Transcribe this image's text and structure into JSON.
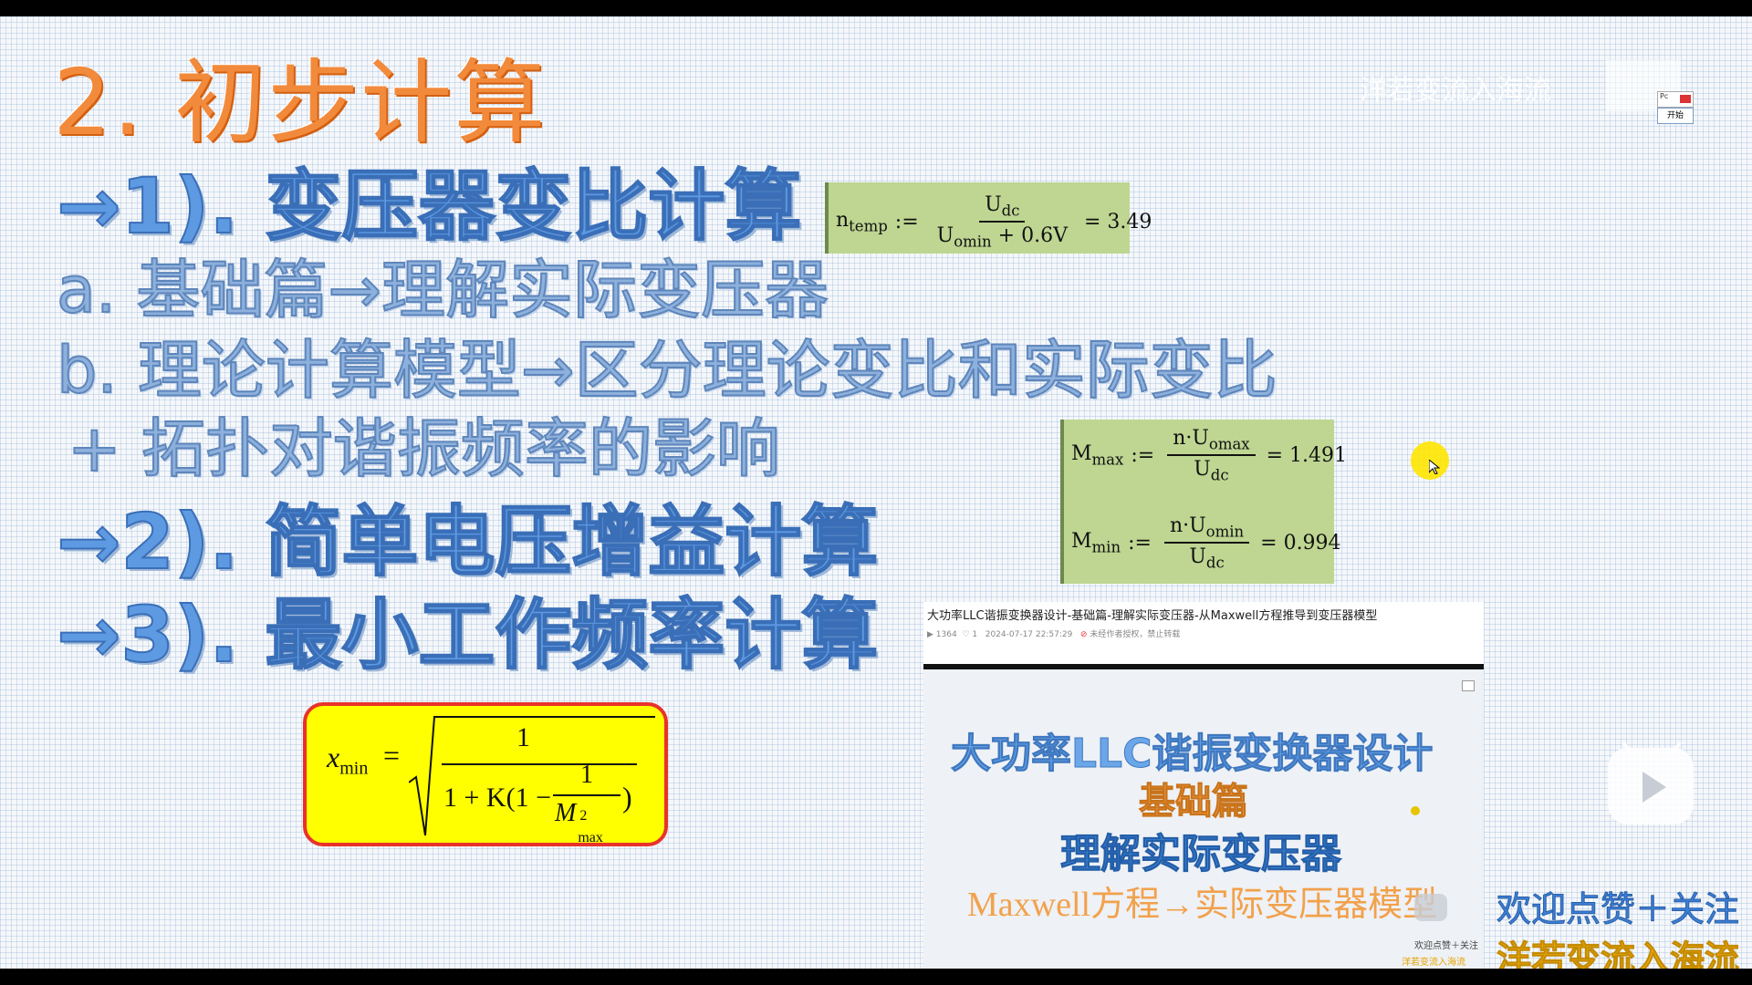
{
  "slide": {
    "title": "2. 初步计算",
    "item1": "→1). 变压器变比计算",
    "item1a": "a. 基础篇→理解实际变压器",
    "item1b": "b. 理论计算模型→区分理论变比和实际变比",
    "item1c": "+ 拓扑对谐振频率的影响",
    "item2": "→2). 简单电压增益计算",
    "item3": "→3). 最小工作频率计算"
  },
  "formulas": {
    "ntemp": {
      "lhs": "n",
      "lhs_sub": "temp",
      "op": ":=",
      "num": "U",
      "num_sub": "dc",
      "den": "U",
      "den_sub": "omin",
      "den_tail": "+ 0.6V",
      "result": "= 3.49"
    },
    "mmax": {
      "lhs": "M",
      "lhs_sub": "max",
      "op": ":=",
      "num": "n·U",
      "num_sub": "omax",
      "den": "U",
      "den_sub": "dc",
      "result": "= 1.491"
    },
    "mmin": {
      "lhs": "M",
      "lhs_sub": "min",
      "op": ":=",
      "num": "n·U",
      "num_sub": "omin",
      "den": "U",
      "den_sub": "dc",
      "result": "= 0.994"
    },
    "xmin": {
      "lhs": "x",
      "lhs_sub": "min",
      "eq": "=",
      "one": "1",
      "den_prefix": "1 + K(1 −",
      "inner_num": "1",
      "inner_den": "M",
      "inner_sup": "2",
      "inner_sub": "max",
      "close": ")"
    }
  },
  "watermark": {
    "top_right": "洋若变流入海流",
    "pc_label": "Pc",
    "start_label": "开始"
  },
  "pip": {
    "article_title": "大功率LLC谐振变换器设计-基础篇-理解实际变压器-从Maxwell方程推导到变压器模型",
    "views": "1364",
    "likes": "1",
    "date": "2024-07-17 22:57:29",
    "notice": "未经作者授权，禁止转载",
    "line1": "大功率LLC谐振变换器设计",
    "line2": "基础篇",
    "line3": "理解实际变压器",
    "line4": "Maxwell方程→实际变压器模型",
    "small_follow": "欢迎点赞＋关注",
    "small_author": "洋若变流入海流"
  },
  "overlay": {
    "follow": "欢迎点赞＋关注",
    "author": "洋若变流入海流"
  },
  "colors": {
    "title_orange": "#f28a3c",
    "heading_blue": "#5d9ae2",
    "formula_green": "#bed692",
    "formula_yellow": "#ffff00",
    "border_red": "#e8322b"
  }
}
